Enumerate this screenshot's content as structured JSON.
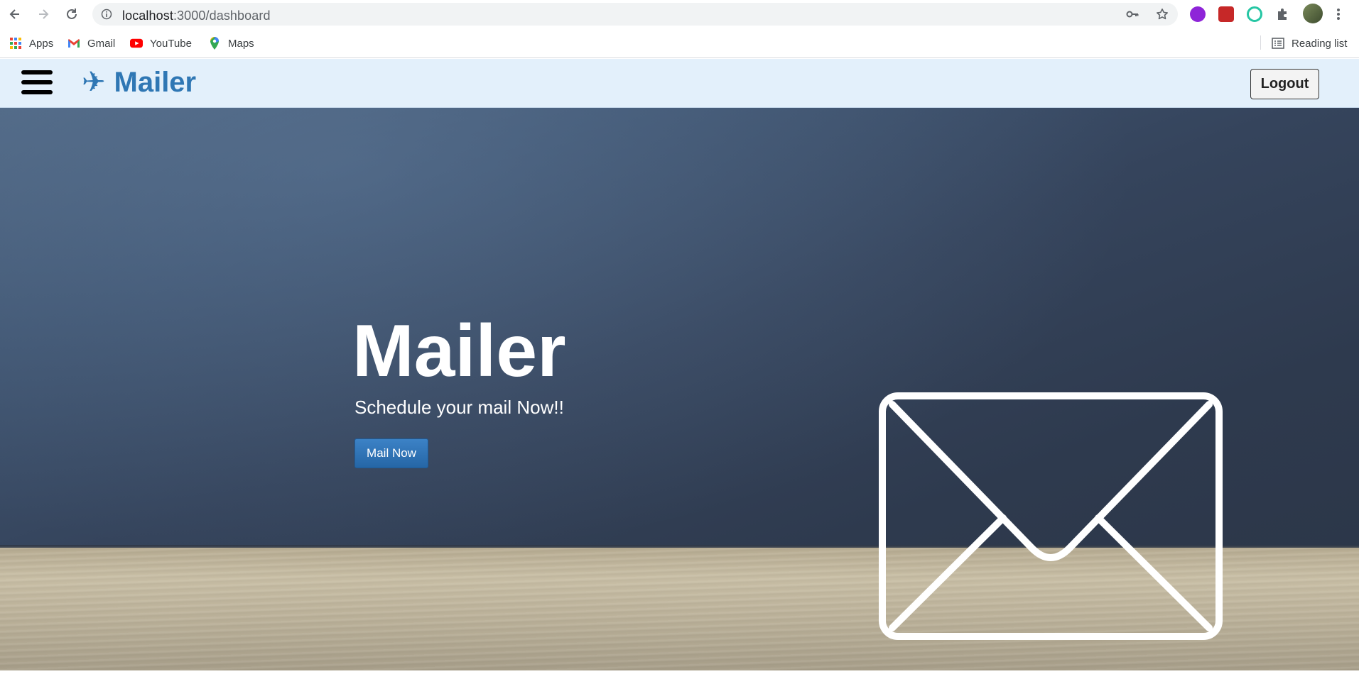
{
  "browser": {
    "url_host": "localhost",
    "url_rest": ":3000/dashboard",
    "bookmarks": [
      {
        "label": "Apps",
        "icon": "apps-grid-icon"
      },
      {
        "label": "Gmail",
        "icon": "gmail-icon"
      },
      {
        "label": "YouTube",
        "icon": "youtube-icon"
      },
      {
        "label": "Maps",
        "icon": "maps-icon"
      }
    ],
    "reading_list": "Reading list"
  },
  "header": {
    "brand": "Mailer",
    "logout_label": "Logout"
  },
  "hero": {
    "title": "Mailer",
    "subtitle": "Schedule your mail Now!!",
    "cta_label": "Mail Now"
  },
  "colors": {
    "brand": "#2f77b4",
    "header_bg": "#e3f0fb",
    "cta": "#2a6eb0",
    "hero_bg": "#35445c"
  }
}
